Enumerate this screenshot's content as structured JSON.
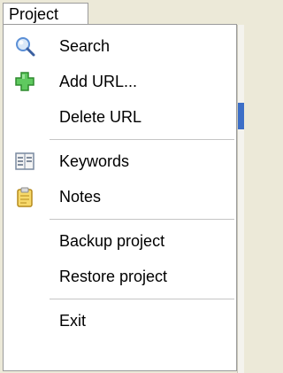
{
  "menubar": {
    "title": "Project"
  },
  "menu": {
    "items": [
      {
        "label": "Search",
        "icon": "search-icon"
      },
      {
        "label": "Add URL...",
        "icon": "add-plus-icon"
      },
      {
        "label": "Delete URL",
        "icon": ""
      },
      {
        "label": "Keywords",
        "icon": "keywords-list-icon"
      },
      {
        "label": "Notes",
        "icon": "notes-clipboard-icon"
      },
      {
        "label": "Backup project",
        "icon": ""
      },
      {
        "label": "Restore project",
        "icon": ""
      },
      {
        "label": "Exit",
        "icon": ""
      }
    ]
  },
  "colors": {
    "menu_bg": "#ffffff",
    "border": "#9b9b9b",
    "separator": "#c5c5c5",
    "window_bg": "#ece9d8",
    "plus_green": "#3aa83a",
    "search_blue": "#5b8fd6",
    "notes_yellow": "#f2c94c"
  }
}
